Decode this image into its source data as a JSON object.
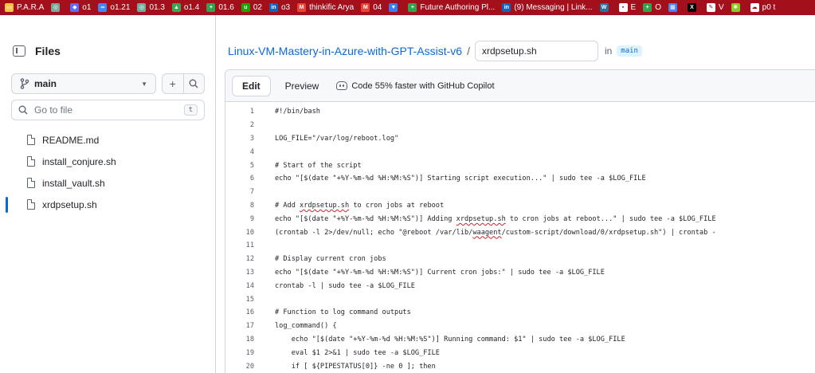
{
  "bookmarks": [
    {
      "label": "P.A.R.A",
      "icon": "folder-icon",
      "color": "#f5c542"
    },
    {
      "label": "",
      "icon": "chatgpt-icon",
      "color": "#74aa9c"
    },
    {
      "label": "o1",
      "icon": "shield-icon",
      "color": "#5b6cff"
    },
    {
      "label": "o1.21",
      "icon": "infinity-icon",
      "color": "#4285f4"
    },
    {
      "label": "01.3",
      "icon": "chatgpt-icon",
      "color": "#74aa9c"
    },
    {
      "label": "o1.4",
      "icon": "drive-icon",
      "color": "#34a853"
    },
    {
      "label": "01.6",
      "icon": "plus-icon",
      "color": "#2da44e"
    },
    {
      "label": "02",
      "icon": "upwork-icon",
      "color": "#14a800"
    },
    {
      "label": "o3",
      "icon": "linkedin-icon",
      "color": "#0a66c2"
    },
    {
      "label": "thinkific Arya",
      "icon": "gmail-icon",
      "color": "#ea4335"
    },
    {
      "label": "04",
      "icon": "gmail-icon",
      "color": "#ea4335"
    },
    {
      "label": "",
      "icon": "bookmark-icon",
      "color": "#2f81f7"
    },
    {
      "label": "Future Authoring Pl...",
      "icon": "plus-icon",
      "color": "#2da44e"
    },
    {
      "label": "(9) Messaging | Link...",
      "icon": "linkedin-icon",
      "color": "#0a66c2"
    },
    {
      "label": "",
      "icon": "wordpress-icon",
      "color": "#21759b"
    },
    {
      "label": "E",
      "icon": "window-icon",
      "color": "#ffffff"
    },
    {
      "label": "O",
      "icon": "plus-icon",
      "color": "#2da44e"
    },
    {
      "label": "",
      "icon": "calendar-icon",
      "color": "#4285f4"
    },
    {
      "label": "",
      "icon": "x-icon",
      "color": "#000000"
    },
    {
      "label": "V",
      "icon": "pen-icon",
      "color": "#ffffff"
    },
    {
      "label": "",
      "icon": "bug-icon",
      "color": "#8ac926"
    },
    {
      "label": "p0 t",
      "icon": "cloud-icon",
      "color": "#ffffff"
    }
  ],
  "sidebar": {
    "title": "Files",
    "branch": "main",
    "search_placeholder": "Go to file",
    "search_shortcut": "t",
    "files": [
      {
        "name": "README.md",
        "active": false
      },
      {
        "name": "install_conjure.sh",
        "active": false
      },
      {
        "name": "install_vault.sh",
        "active": false
      },
      {
        "name": "xrdpsetup.sh",
        "active": true
      }
    ]
  },
  "main": {
    "repo": "Linux-VM-Mastery-in-Azure-with-GPT-Assist-v6",
    "separator": "/",
    "filename": "xrdpsetup.sh",
    "in_label": "in",
    "branch": "main",
    "tabs": [
      {
        "label": "Edit",
        "active": true
      },
      {
        "label": "Preview",
        "active": false
      }
    ],
    "copilot": "Code 55% faster with GitHub Copilot"
  },
  "code": [
    {
      "n": "1",
      "text": "#!/bin/bash"
    },
    {
      "n": "2",
      "text": ""
    },
    {
      "n": "3",
      "text": "LOG_FILE=\"/var/log/reboot.log\""
    },
    {
      "n": "4",
      "text": ""
    },
    {
      "n": "5",
      "text": "# Start of the script"
    },
    {
      "n": "6",
      "text": "echo \"[$(date \"+%Y-%m-%d %H:%M:%S\")] Starting script execution...\" | sudo tee -a $LOG_FILE"
    },
    {
      "n": "7",
      "text": ""
    },
    {
      "n": "8",
      "text": "# Add xrdpsetup.sh to cron jobs at reboot"
    },
    {
      "n": "9",
      "text": "echo \"[$(date \"+%Y-%m-%d %H:%M:%S\")] Adding xrdpsetup.sh to cron jobs at reboot...\" | sudo tee -a $LOG_FILE"
    },
    {
      "n": "10",
      "text": "(crontab -l 2>/dev/null; echo \"@reboot /var/lib/waagent/custom-script/download/0/xrdpsetup.sh\") | crontab -"
    },
    {
      "n": "11",
      "text": ""
    },
    {
      "n": "12",
      "text": "# Display current cron jobs"
    },
    {
      "n": "13",
      "text": "echo \"[$(date \"+%Y-%m-%d %H:%M:%S\")] Current cron jobs:\" | sudo tee -a $LOG_FILE"
    },
    {
      "n": "14",
      "text": "crontab -l | sudo tee -a $LOG_FILE"
    },
    {
      "n": "15",
      "text": ""
    },
    {
      "n": "16",
      "text": "# Function to log command outputs"
    },
    {
      "n": "17",
      "text": "log_command() {"
    },
    {
      "n": "18",
      "text": "    echo \"[$(date \"+%Y-%m-%d %H:%M:%S\")] Running command: $1\" | sudo tee -a $LOG_FILE"
    },
    {
      "n": "19",
      "text": "    eval $1 2>&1 | sudo tee -a $LOG_FILE"
    },
    {
      "n": "20",
      "text": "    if [ ${PIPESTATUS[0]} -ne 0 ]; then"
    }
  ]
}
